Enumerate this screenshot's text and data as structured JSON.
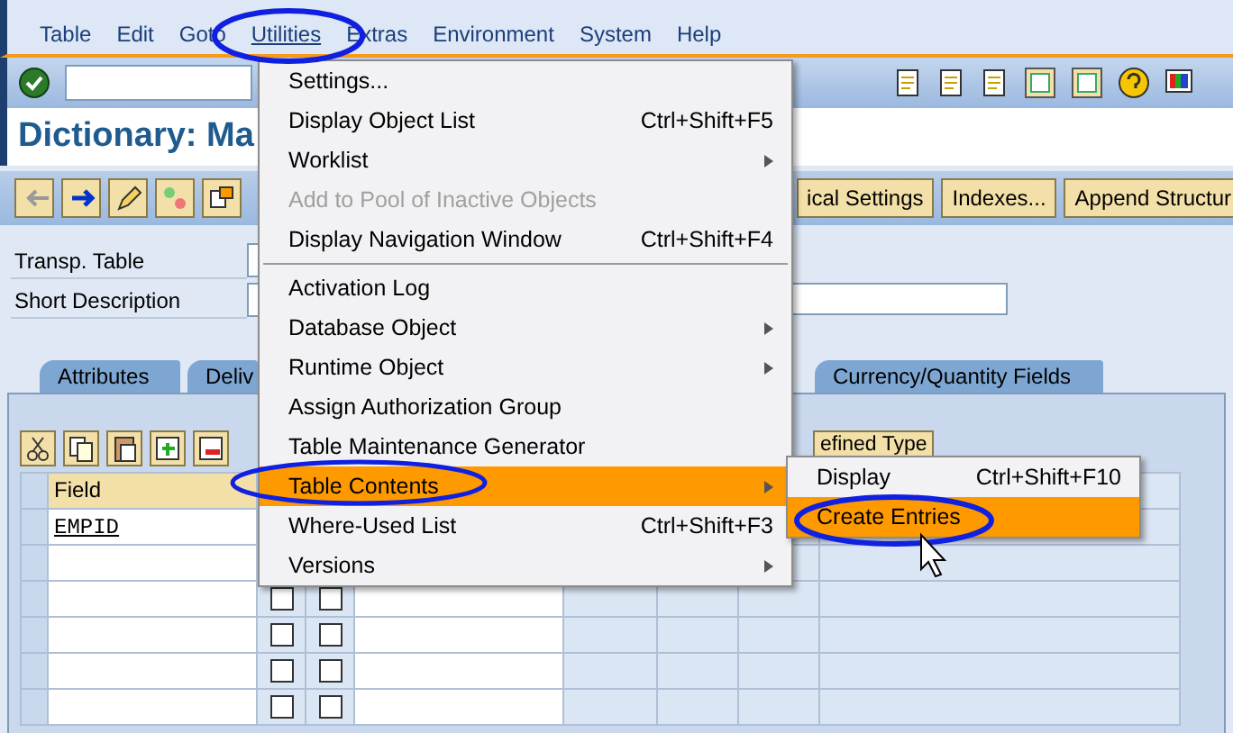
{
  "menu_bar": [
    {
      "label": "Table",
      "selected": false
    },
    {
      "label": "Edit",
      "selected": false
    },
    {
      "label": "Goto",
      "selected": false
    },
    {
      "label": "Utilities",
      "selected": true
    },
    {
      "label": "Extras",
      "selected": false
    },
    {
      "label": "Environment",
      "selected": false
    },
    {
      "label": "System",
      "selected": false
    },
    {
      "label": "Help",
      "selected": false
    }
  ],
  "title": "Dictionary: Ma",
  "app_toolbar": {
    "buttons": [
      {
        "label": "ical Settings"
      },
      {
        "label": "Indexes..."
      },
      {
        "label": "Append Structur"
      }
    ]
  },
  "form": {
    "fields": [
      {
        "label": "Transp. Table",
        "kind": "short"
      },
      {
        "label": "Short Description",
        "kind": "long"
      }
    ]
  },
  "tabs": [
    {
      "label": "Attributes",
      "selected": false
    },
    {
      "label": "Deliv",
      "selected": false
    },
    {
      "label": "Currency/Quantity Fields",
      "selected": false
    }
  ],
  "table": {
    "type_button": "efined Type",
    "columns": [
      "Field"
    ],
    "rows": [
      {
        "field": "EMPID"
      },
      {
        "field": ""
      },
      {
        "field": "",
        "key": false,
        "initial": false
      },
      {
        "field": "",
        "key": false,
        "initial": false
      },
      {
        "field": "",
        "key": false,
        "initial": false
      },
      {
        "field": "",
        "key": false,
        "initial": false
      }
    ]
  },
  "menu": {
    "items": [
      {
        "kind": "item",
        "label": "Settings...",
        "disabled": false,
        "submenu": false,
        "selected": false
      },
      {
        "kind": "item",
        "label": "Display Object List",
        "shortcut": "Ctrl+Shift+F5",
        "disabled": false,
        "submenu": false,
        "selected": false
      },
      {
        "kind": "item",
        "label": "Worklist",
        "disabled": false,
        "submenu": true,
        "selected": false
      },
      {
        "kind": "item",
        "label": "Add to Pool of Inactive Objects",
        "disabled": true,
        "submenu": false,
        "selected": false
      },
      {
        "kind": "item",
        "label": "Display Navigation Window",
        "shortcut": "Ctrl+Shift+F4",
        "disabled": false,
        "submenu": false,
        "selected": false
      },
      {
        "kind": "separator"
      },
      {
        "kind": "item",
        "label": "Activation Log",
        "disabled": false,
        "submenu": false,
        "selected": false
      },
      {
        "kind": "item",
        "label": "Database Object",
        "disabled": false,
        "submenu": true,
        "selected": false
      },
      {
        "kind": "item",
        "label": "Runtime Object",
        "disabled": false,
        "submenu": true,
        "selected": false
      },
      {
        "kind": "item",
        "label": "Assign Authorization Group",
        "disabled": false,
        "submenu": false,
        "selected": false
      },
      {
        "kind": "item",
        "label": "Table Maintenance Generator",
        "disabled": false,
        "submenu": false,
        "selected": false
      },
      {
        "kind": "item",
        "label": "Table Contents",
        "disabled": false,
        "submenu": true,
        "selected": true
      },
      {
        "kind": "item",
        "label": "Where-Used List",
        "shortcut": "Ctrl+Shift+F3",
        "disabled": false,
        "submenu": false,
        "selected": false
      },
      {
        "kind": "item",
        "label": "Versions",
        "disabled": false,
        "submenu": true,
        "selected": false
      }
    ]
  },
  "submenu": {
    "items": [
      {
        "kind": "item",
        "label": "Display",
        "shortcut": "Ctrl+Shift+F10",
        "disabled": false,
        "submenu": false,
        "selected": false
      },
      {
        "kind": "item",
        "label": "Create Entries",
        "disabled": false,
        "submenu": false,
        "selected": true
      }
    ]
  }
}
